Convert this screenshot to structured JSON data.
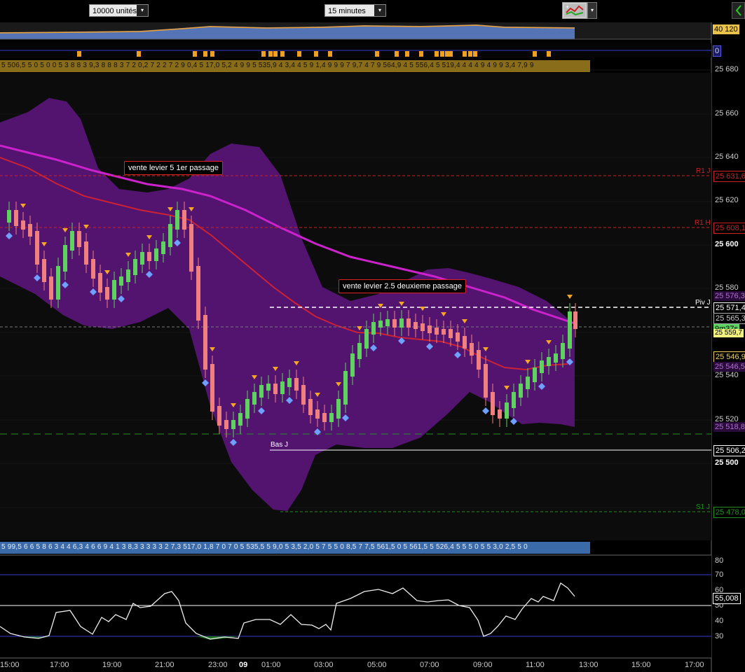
{
  "toolbar": {
    "units_select": "10000 unités",
    "period_select": "15 minutes",
    "chevron": "▾",
    "tool_icon": "indicator-tool-icon",
    "colors": {
      "panel_bg": "#000000",
      "select_bg": "#e8e8e8"
    }
  },
  "overview": {
    "value_tag": "40 120"
  },
  "signal_bar": {
    "value_tag": "0"
  },
  "top_strip_text": "5 506,5 5 0 5 0 0 5 3 8 8 3 9,3 8 8 8 3 7 2 0,2 7 2 2 7 2 9 0,4 5 17,0 5,2 4 9 9 5 535,9 4 3,4 4 5 9 1,4 9 9 9 7 9,7 4 7 9 564,9 4 5 556,4 5 519,4 4 4 4 9 4 9 9 3,4 7,9 9",
  "bottom_strip_text": "5 99,5 6 6 5 8 6 3 4 4 6,3 4 6 6 9 4 1 3 8,3 3 3 3 3 2 7,3 517,0 1,8 7 0 7 0 5 535,5 5 9,0 5 3,5 2,0 5 7 5 5 0 8,5 7 7,5 561,5 0 5 561,5 5 526,4 5 5 5 0 5 5 3,0 2,5 5 0",
  "price_axis": {
    "ticks": [
      "25 680",
      "25 660",
      "25 640",
      "25 620",
      "25 600",
      "25 580",
      "25 540",
      "25 520",
      "25 500"
    ],
    "bold_ticks": [
      "25 600",
      "25 500"
    ]
  },
  "price_tags": {
    "r1j": "25 631,6",
    "r1h": "25 608,1",
    "tag_576": "25 576,3",
    "pivot": "25 571,4",
    "tag_565": "25 565,3",
    "timer": "9m37s",
    "current": "25 559,7",
    "tag_546a": "25 546,9",
    "tag_546b": "25 546,5",
    "tag_518": "25 518,8",
    "low": "25 506,2",
    "s1j": "25 478,0"
  },
  "level_labels": {
    "r1j": "R1 J",
    "r1h": "R1 H",
    "pivot": "Piv J",
    "bas": "Bas J",
    "s1j": "S1 J"
  },
  "annotations": {
    "note1": "vente levier 5 1er passage",
    "note2": "vente levier 2.5 deuxieme passage"
  },
  "oscillator": {
    "ticks": [
      "80",
      "70",
      "60",
      "50",
      "40",
      "30"
    ],
    "value_tag": "55,008"
  },
  "time_axis": [
    "15:00",
    "17:00",
    "19:00",
    "21:00",
    "23:00",
    "09",
    "01:00",
    "03:00",
    "05:00",
    "07:00",
    "09:00",
    "11:00",
    "13:00",
    "15:00",
    "17:00"
  ],
  "colors": {
    "up": "#5fd35f",
    "down": "#f08080",
    "band": "#6a1a8e",
    "ma": "#cc22cc",
    "arrow": "#f5a623",
    "diamond": "#6fa0ff",
    "r1": "#cc2222",
    "s1": "#1f8f1f"
  }
}
